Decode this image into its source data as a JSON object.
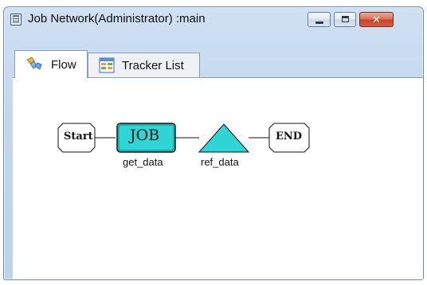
{
  "window": {
    "title": "Job Network(Administrator) :main",
    "controls": {
      "minimize_icon": "minimize-icon",
      "maximize_icon": "maximize-icon",
      "close_icon": "close-icon",
      "close_glyph": "✕"
    }
  },
  "tabs": [
    {
      "label": "Flow",
      "icon": "flow-icon",
      "selected": true
    },
    {
      "label": "Tracker List",
      "icon": "tracker-list-icon",
      "selected": false
    }
  ],
  "flow": {
    "start": {
      "text": "Start"
    },
    "job": {
      "text": "JOB",
      "label": "get_data"
    },
    "unit": {
      "label": "ref_data"
    },
    "end": {
      "text": "END"
    }
  },
  "colors": {
    "node_fill": "#2fd4d4",
    "node_border": "#101010"
  }
}
